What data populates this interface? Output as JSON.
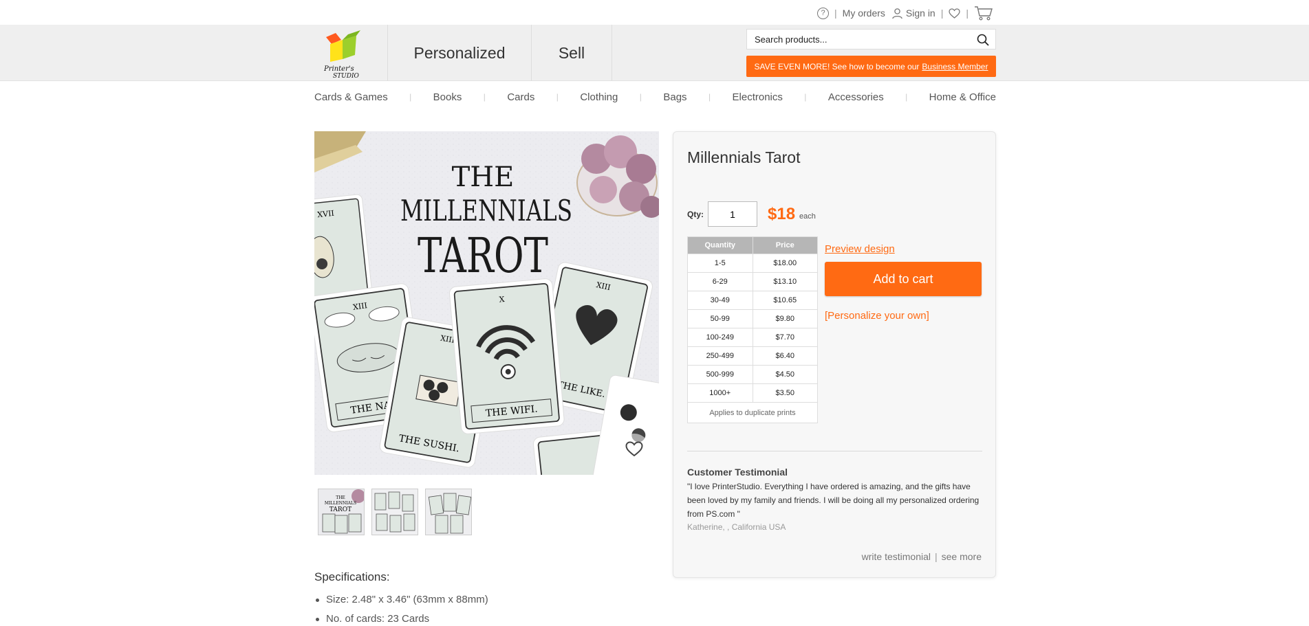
{
  "topbar": {
    "my_orders": "My orders",
    "sign_in": "Sign in",
    "help_glyph": "?"
  },
  "header": {
    "logo_line1": "Printer's",
    "logo_line2": "STUDIO",
    "nav": [
      "Personalized",
      "Sell"
    ],
    "search_placeholder": "Search products...",
    "promo_text": "SAVE EVEN MORE! See how to become our",
    "promo_link": "Business Member"
  },
  "categories": [
    "Cards & Games",
    "Books",
    "Cards",
    "Clothing",
    "Bags",
    "Electronics",
    "Accessories",
    "Home & Office"
  ],
  "gallery": {
    "main_image_label": "THE MILLENNIALS TAROT",
    "title_lines": [
      "THE",
      "MILLENNIALS",
      "TAROT"
    ],
    "card_labels": [
      "THE NAP.",
      "THE SUSHI.",
      "THE WIFI.",
      "THE LIKE."
    ],
    "card_numerals": [
      "XVII",
      "XIII",
      "XIII",
      "X",
      "XIII"
    ],
    "thumb_count": 3
  },
  "product": {
    "title": "Millennials Tarot",
    "qty_label": "Qty:",
    "qty_value": "1",
    "price": "$18",
    "price_unit": "each",
    "table_headers": [
      "Quantity",
      "Price"
    ],
    "table_rows": [
      [
        "1-5",
        "$18.00"
      ],
      [
        "6-29",
        "$13.10"
      ],
      [
        "30-49",
        "$10.65"
      ],
      [
        "50-99",
        "$9.80"
      ],
      [
        "100-249",
        "$7.70"
      ],
      [
        "250-499",
        "$6.40"
      ],
      [
        "500-999",
        "$4.50"
      ],
      [
        "1000+",
        "$3.50"
      ]
    ],
    "table_note": "Applies to duplicate prints",
    "preview_link": "Preview design",
    "add_to_cart": "Add to cart",
    "personalize_link": "[Personalize your own]"
  },
  "testimonial": {
    "title": "Customer Testimonial",
    "body": "\"I love PrinterStudio. Everything I have ordered is amazing, and the gifts have been loved by my family and friends. I will be doing all my personalized ordering from PS.com \"",
    "author": "Katherine, , California USA",
    "write_link": "write testimonial",
    "more_link": "see more"
  },
  "specs": {
    "title": "Specifications:",
    "items": [
      "Size: 2.48\" x 3.46\" (63mm x 88mm)",
      "No. of cards: 23 Cards"
    ]
  },
  "colors": {
    "accent": "#ff6a13",
    "header_bg": "#efefef",
    "table_header": "#b6b6b6"
  }
}
